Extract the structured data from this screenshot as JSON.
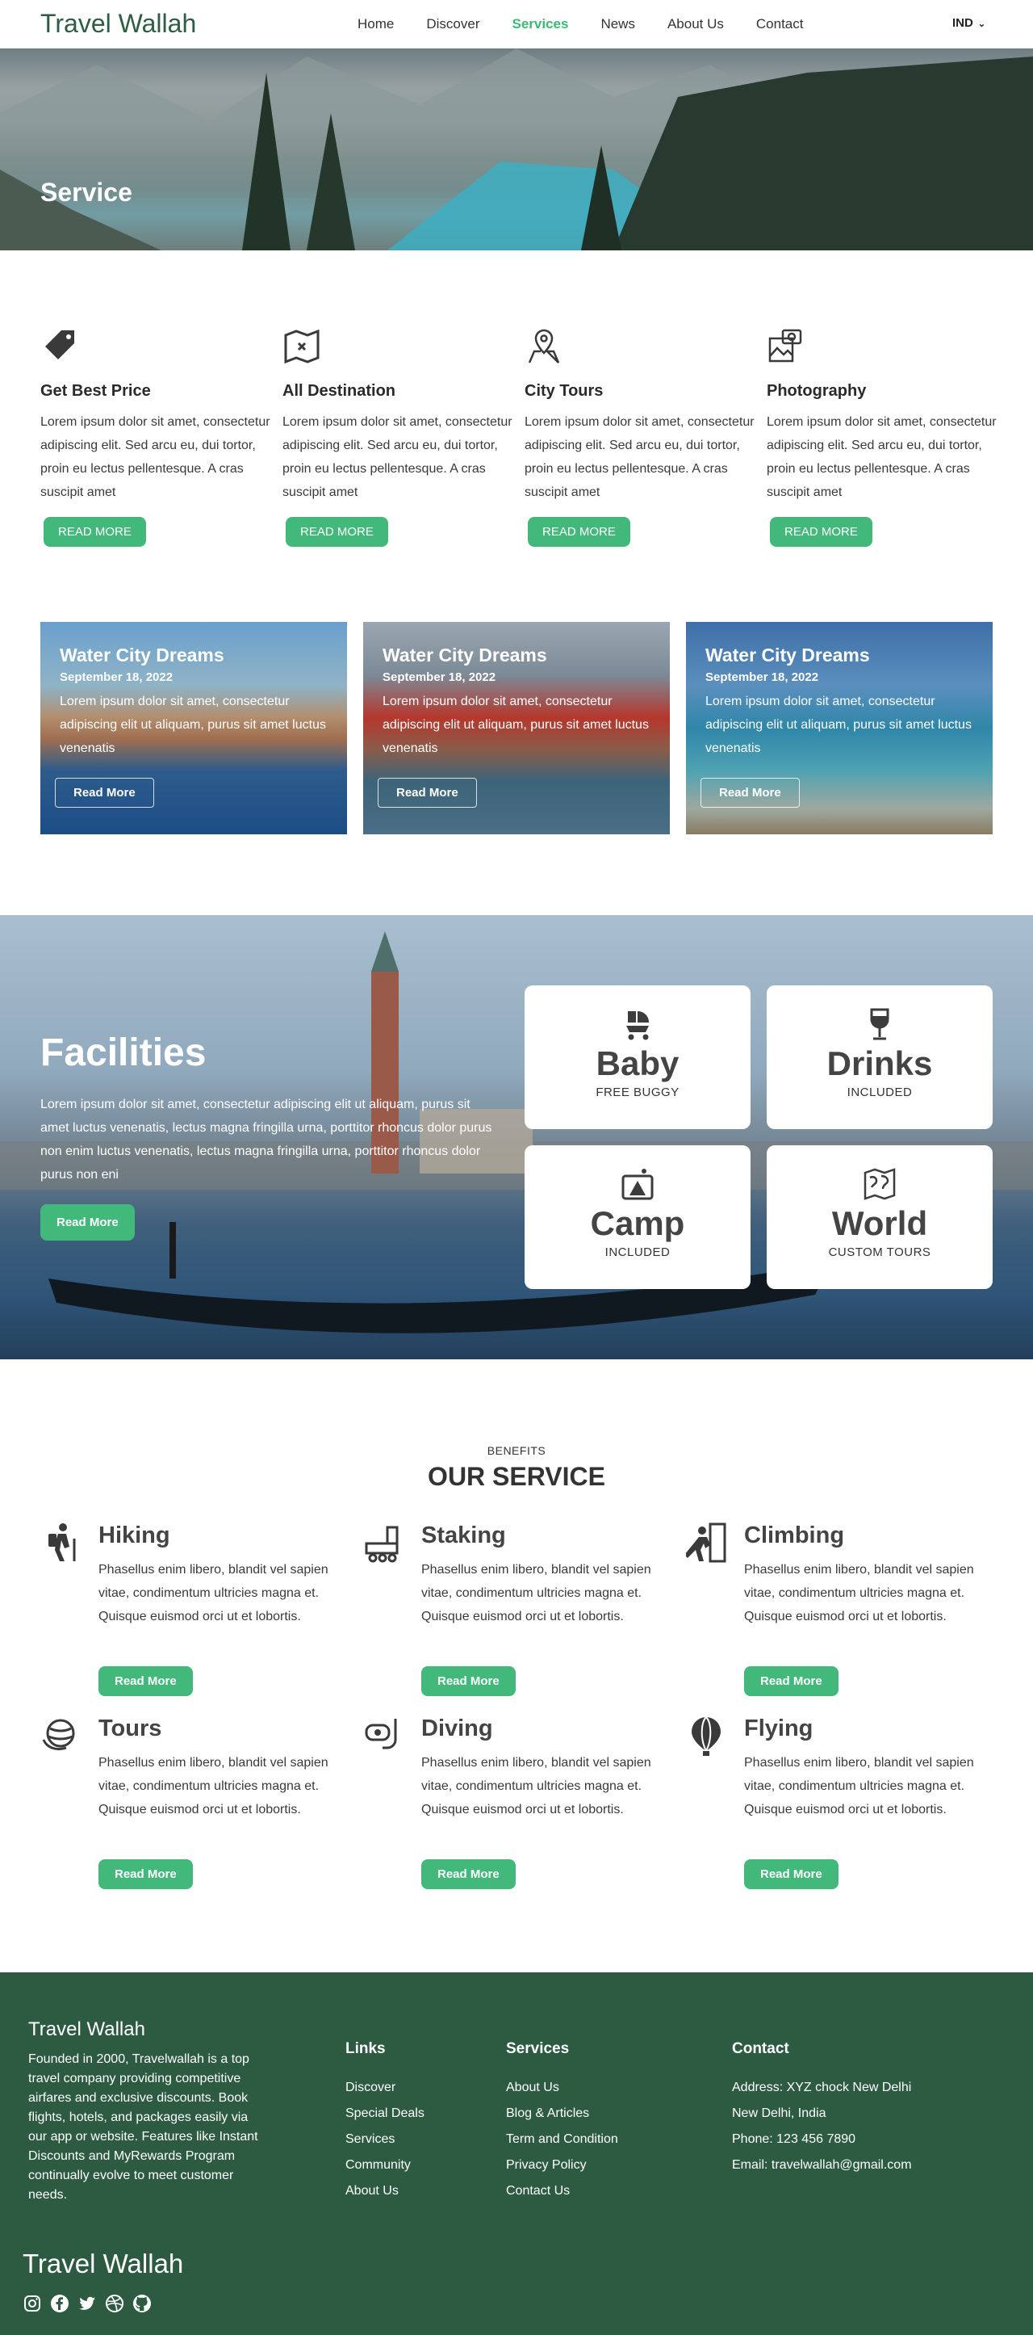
{
  "nav": {
    "brand": "Travel Wallah",
    "items": [
      {
        "label": "Home"
      },
      {
        "label": "Discover"
      },
      {
        "label": "Services",
        "active": true
      },
      {
        "label": "News"
      },
      {
        "label": "About Us"
      },
      {
        "label": "Contact"
      }
    ],
    "language": "IND"
  },
  "hero": {
    "title": "Service"
  },
  "features": [
    {
      "icon": "price-tag-icon",
      "title": "Get Best Price",
      "text": "Lorem ipsum dolor sit amet, consectetur adipiscing elit. Sed arcu eu, dui tortor, proin eu lectus pellentesque. A cras suscipit amet",
      "button": "READ MORE"
    },
    {
      "icon": "map-icon",
      "title": "All Destination",
      "text": "Lorem ipsum dolor sit amet, consectetur adipiscing elit. Sed arcu eu, dui tortor, proin eu lectus pellentesque. A cras suscipit amet",
      "button": "READ MORE"
    },
    {
      "icon": "map-pin-icon",
      "title": "City Tours",
      "text": "Lorem ipsum dolor sit amet, consectetur adipiscing elit. Sed arcu eu, dui tortor, proin eu lectus pellentesque. A cras suscipit amet",
      "button": "READ MORE"
    },
    {
      "icon": "photo-icon",
      "title": "Photography",
      "text": "Lorem ipsum dolor sit amet, consectetur adipiscing elit. Sed arcu eu, dui tortor, proin eu lectus pellentesque. A cras suscipit amet",
      "button": "READ MORE"
    }
  ],
  "cards": [
    {
      "title": "Water City Dreams",
      "date": "September 18, 2022",
      "text": "Lorem ipsum dolor sit amet, consectetur adipiscing elit ut aliquam, purus sit amet luctus venenatis",
      "button": "Read More"
    },
    {
      "title": "Water City Dreams",
      "date": "September 18, 2022",
      "text": "Lorem ipsum dolor sit amet, consectetur adipiscing elit ut aliquam, purus sit amet luctus venenatis",
      "button": "Read More"
    },
    {
      "title": "Water City Dreams",
      "date": "September 18, 2022",
      "text": "Lorem ipsum dolor sit amet, consectetur adipiscing elit ut aliquam, purus sit amet luctus venenatis",
      "button": "Read More"
    }
  ],
  "facilities": {
    "title": "Facilities",
    "text": "Lorem ipsum dolor sit amet, consectetur adipiscing elit ut aliquam, purus sit amet luctus venenatis, lectus magna fringilla urna, porttitor rhoncus dolor purus non enim luctus venenatis, lectus magna fringilla urna, porttitor rhoncus dolor purus non eni",
    "button": "Read More",
    "boxes": [
      {
        "icon": "stroller-icon",
        "big": "Baby",
        "small": "FREE BUGGY"
      },
      {
        "icon": "wine-glass-icon",
        "big": "Drinks",
        "small": "INCLUDED"
      },
      {
        "icon": "camp-icon",
        "big": "Camp",
        "small": "INCLUDED"
      },
      {
        "icon": "world-map-icon",
        "big": "World",
        "small": "CUSTOM TOURS"
      }
    ]
  },
  "services": {
    "kicker": "BENEFITS",
    "title": "OUR SERVICE",
    "items": [
      {
        "icon": "hiker-icon",
        "title": "Hiking",
        "text": "Phasellus enim libero, blandit vel sapien vitae, condimentum ultricies magna et. Quisque euismod orci ut et lobortis.",
        "button": "Read More"
      },
      {
        "icon": "skate-icon",
        "title": "Staking",
        "text": "Phasellus enim libero, blandit vel sapien vitae, condimentum ultricies magna et. Quisque euismod orci ut et lobortis.",
        "button": "Read More"
      },
      {
        "icon": "climber-icon",
        "title": "Climbing",
        "text": "Phasellus enim libero, blandit vel sapien vitae, condimentum ultricies magna et. Quisque euismod orci ut et lobortis.",
        "button": "Read More"
      },
      {
        "icon": "globe-icon",
        "title": "Tours",
        "text": "Phasellus enim libero, blandit vel sapien vitae, condimentum ultricies magna et. Quisque euismod orci ut et lobortis.",
        "button": "Read More"
      },
      {
        "icon": "snorkel-icon",
        "title": "Diving",
        "text": "Phasellus enim libero, blandit vel sapien vitae, condimentum ultricies magna et. Quisque euismod orci ut et lobortis.",
        "button": "Read More"
      },
      {
        "icon": "balloon-icon",
        "title": "Flying",
        "text": "Phasellus enim libero, blandit vel sapien vitae, condimentum ultricies magna et. Quisque euismod orci ut et lobortis.",
        "button": "Read More"
      }
    ]
  },
  "footer": {
    "brand": "Travel Wallah",
    "about": "Founded in 2000, Travelwallah is a top travel company providing competitive airfares and exclusive discounts. Book flights, hotels, and packages easily via our app or website. Features like Instant Discounts and MyRewards Program continually evolve to meet customer needs.",
    "links": {
      "title": "Links",
      "items": [
        "Discover",
        "Special Deals",
        "Services",
        "Community",
        "About Us"
      ]
    },
    "services": {
      "title": "Services",
      "items": [
        "About Us",
        "Blog & Articles",
        "Term and Condition",
        "Privacy Policy",
        "Contact Us"
      ]
    },
    "contact": {
      "title": "Contact",
      "items": [
        "Address: XYZ chock New Delhi",
        "New Delhi, India",
        "Phone: 123 456 7890",
        "Email: travelwallah@gmail.com"
      ]
    },
    "brand2": "Travel Wallah",
    "socials": [
      "instagram-icon",
      "facebook-icon",
      "twitter-icon",
      "dribbble-icon",
      "github-icon"
    ]
  },
  "colors": {
    "accent": "#43b87b",
    "footer_bg": "#2c5b42",
    "brand": "#2d5e43"
  }
}
